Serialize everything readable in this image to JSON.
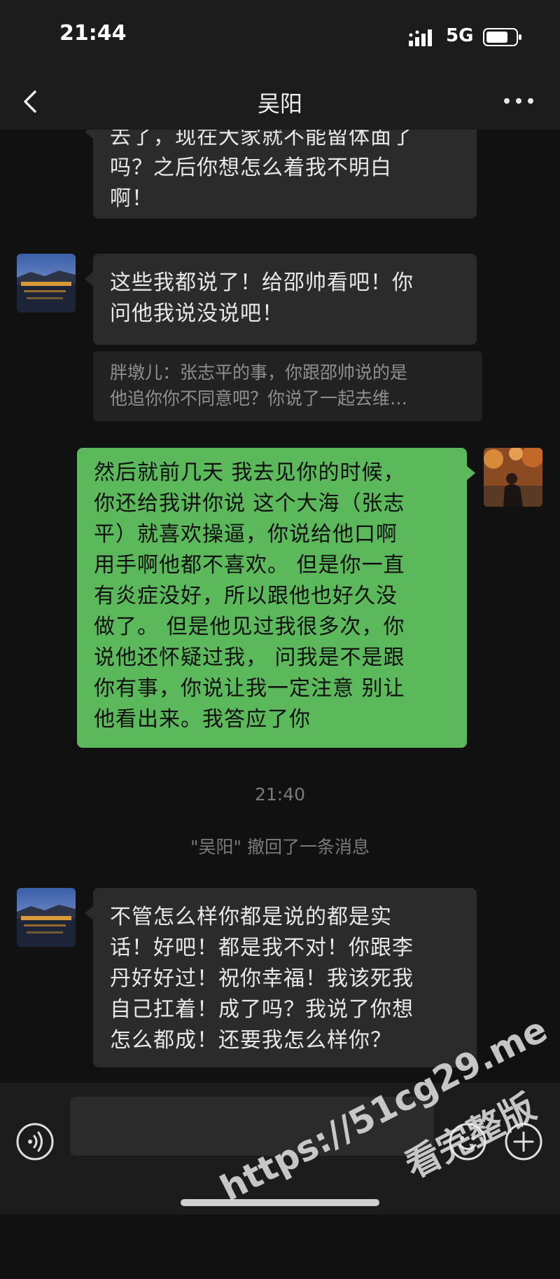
{
  "status_bar": {
    "time": "21:44",
    "network": "5G",
    "icons": [
      "signal-icon",
      "battery-icon"
    ]
  },
  "nav": {
    "title": "吴阳",
    "icons": [
      "back-chevron-icon",
      "more-dots-icon"
    ]
  },
  "messages": [
    {
      "direction": "in",
      "lines": [
        "去了，现在大家就不能留体面了",
        "吗？之后你想怎么着我不明白",
        "啊！"
      ]
    },
    {
      "direction": "in",
      "lines": [
        "这些我都说了！给邵帅看吧！你",
        "问他我说没说吧！"
      ],
      "quote": [
        "胖墩儿：张志平的事，你跟邵帅说的是",
        "他追你你不同意吧？你说了一起去维…"
      ]
    },
    {
      "direction": "out",
      "lines": [
        "然后就前几天 我去见你的时候，",
        "你还给我讲你说 这个大海（张志",
        "平）就喜欢操逼，你说给他口啊",
        "用手啊他都不喜欢。 但是你一直",
        "有炎症没好，所以跟他也好久没",
        "做了。 但是他见过我很多次，你",
        "说他还怀疑过我， 问我是不是跟",
        "你有事，你说让我一定注意 别让",
        "他看出来。我答应了你"
      ]
    },
    {
      "direction": "in",
      "lines": [
        "不管怎么样你都是说的都是实",
        "话！好吧！都是我不对！你跟李",
        "丹好好过！祝你幸福！我该死我",
        "自己扛着！成了吗？我说了你想",
        "怎么都成！还要我怎么样你？"
      ]
    }
  ],
  "timestamp": "21:40",
  "recall_notice": "\"吴阳\" 撤回了一条消息",
  "input_bar": {
    "placeholder": "",
    "icons": [
      "voice-icon",
      "emoji-icon",
      "plus-icon"
    ]
  },
  "watermark": {
    "line1": "https://51cg29.me",
    "line2": "看完整版"
  },
  "colors": {
    "background": "#111111",
    "incoming_bubble": "#2b2b2b",
    "outgoing_bubble": "#5bb85b",
    "bar": "#1c1c1c"
  }
}
